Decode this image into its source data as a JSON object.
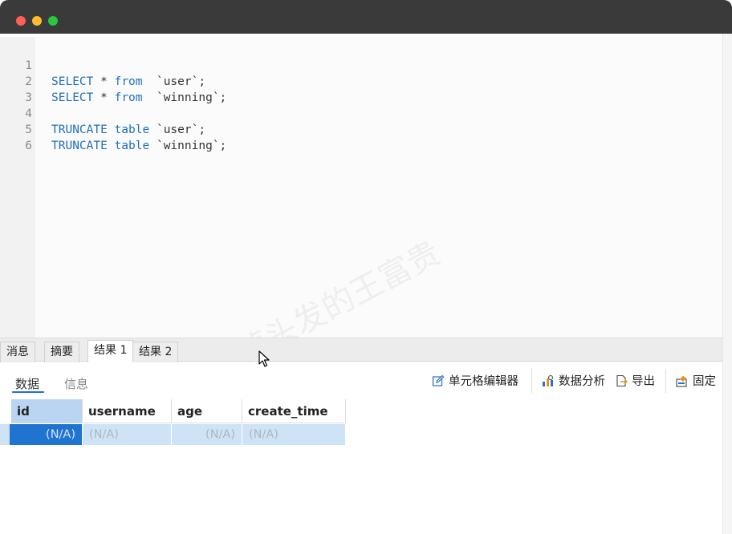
{
  "editor": {
    "lines": [
      {
        "num": "1",
        "kw": "SELECT",
        "rest": " * ",
        "kw2": "from",
        "tail": "  `user`;"
      },
      {
        "num": "2",
        "kw": "SELECT",
        "rest": " * ",
        "kw2": "from",
        "tail": "  `winning`;"
      },
      {
        "num": "3",
        "kw": "",
        "rest": "",
        "kw2": "",
        "tail": ""
      },
      {
        "num": "4",
        "kw": "TRUNCATE",
        "rest": " ",
        "kw2": "table",
        "tail": " `user`;"
      },
      {
        "num": "5",
        "kw": "TRUNCATE",
        "rest": " ",
        "kw2": "table",
        "tail": " `winning`;"
      },
      {
        "num": "6",
        "kw": "",
        "rest": "",
        "kw2": "",
        "tail": ""
      }
    ],
    "watermark": "掉头发的王富贵"
  },
  "result_tabs": [
    {
      "label": "消息",
      "active": false
    },
    {
      "label": "摘要",
      "active": false
    },
    {
      "label": "结果 1",
      "active": true
    },
    {
      "label": "结果 2",
      "active": false
    }
  ],
  "sub_tabs": {
    "data": "数据",
    "info": "信息"
  },
  "toolbar": {
    "cell_editor": "单元格编辑器",
    "data_analysis": "数据分析",
    "export": "导出",
    "pin": "固定"
  },
  "table": {
    "columns": [
      "id",
      "username",
      "age",
      "create_time"
    ],
    "row": [
      "(N/A)",
      "(N/A)",
      "(N/A)",
      "(N/A)"
    ]
  },
  "colors": {
    "keyword": "#1f6fbf",
    "accent": "#1f73d1",
    "selected_row": "#cfe3f7"
  }
}
